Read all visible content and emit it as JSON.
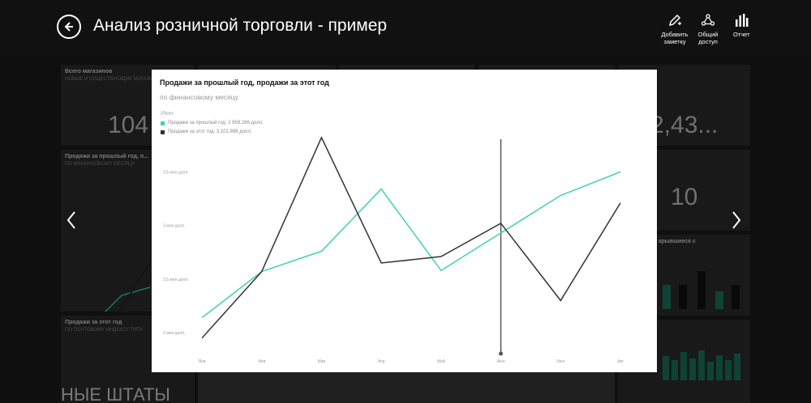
{
  "header": {
    "title": "Анализ розничной торговли - пример",
    "actions": [
      {
        "icon": "pen-note-icon",
        "label": "Добавить заметку"
      },
      {
        "icon": "share-icon",
        "label": "Общий доступ"
      },
      {
        "icon": "bar-chart-icon",
        "label": "Отчет"
      }
    ]
  },
  "backdrop": {
    "tile_total_stores_title": "Всего магазинов",
    "tile_total_stores_sub": "НОВЫЕ И СУЩЕСТВУЮЩИЕ МАГАЗИНЫ",
    "tile_total_stores_value": "104",
    "tile_right_value": "2,43...",
    "tile_right_value2": "10",
    "tile_sales_title": "Продажи за прошлый год, п...",
    "tile_sales_sub": "ПО ФИНАНСОВОМУ МЕСЯЦУ",
    "tile_sales2_title": "Продажи за этот год",
    "tile_sales2_sub": "ПО ПОЧТОВОМУ ИНДЕКСУ ТИПУ",
    "tile_map_text": "НЫЕ ШТАТЫ",
    "tile_right_title": "крывшиеся с"
  },
  "modal": {
    "title": "Продажи за прошлый год, продажи за этот год",
    "subtitle": "по финансовому месяцу",
    "legend_title": "Июн",
    "legend_prev": "Продажи за прошлый год: 2 958,286 долл.",
    "legend_curr": "Продажи за этот год: 3,102,898 долл."
  },
  "colors": {
    "last_year": "#3fd1b2",
    "this_year": "#333333",
    "background": "#111111",
    "modal_bg": "#ffffff"
  },
  "chart_data": {
    "type": "line",
    "title": "Продажи за прошлый год, продажи за этот год",
    "subtitle": "по финансовому месяцу",
    "categories": [
      "Янв",
      "Фев",
      "Мар",
      "Апр",
      "Май",
      "Июн",
      "Июл",
      "Авг"
    ],
    "ytick_labels": [
      "2 млн долл.",
      "2,5 млн долл.",
      "3 млн долл.",
      "3,5 млн долл."
    ],
    "ytick_values": [
      2.0,
      2.5,
      3.0,
      3.5
    ],
    "ylim": [
      1.85,
      3.85
    ],
    "highlight_category": "Июн",
    "series": [
      {
        "name": "Продажи за прошлый год",
        "color": "#3fd1b2",
        "values": [
          2.14,
          2.57,
          2.76,
          3.34,
          2.58,
          2.93,
          3.28,
          3.5
        ]
      },
      {
        "name": "Продажи за этот год",
        "color": "#333333",
        "values": [
          1.95,
          2.57,
          3.82,
          2.65,
          2.71,
          3.02,
          2.3,
          3.21
        ]
      }
    ],
    "grid": false,
    "legend": "top-left"
  }
}
